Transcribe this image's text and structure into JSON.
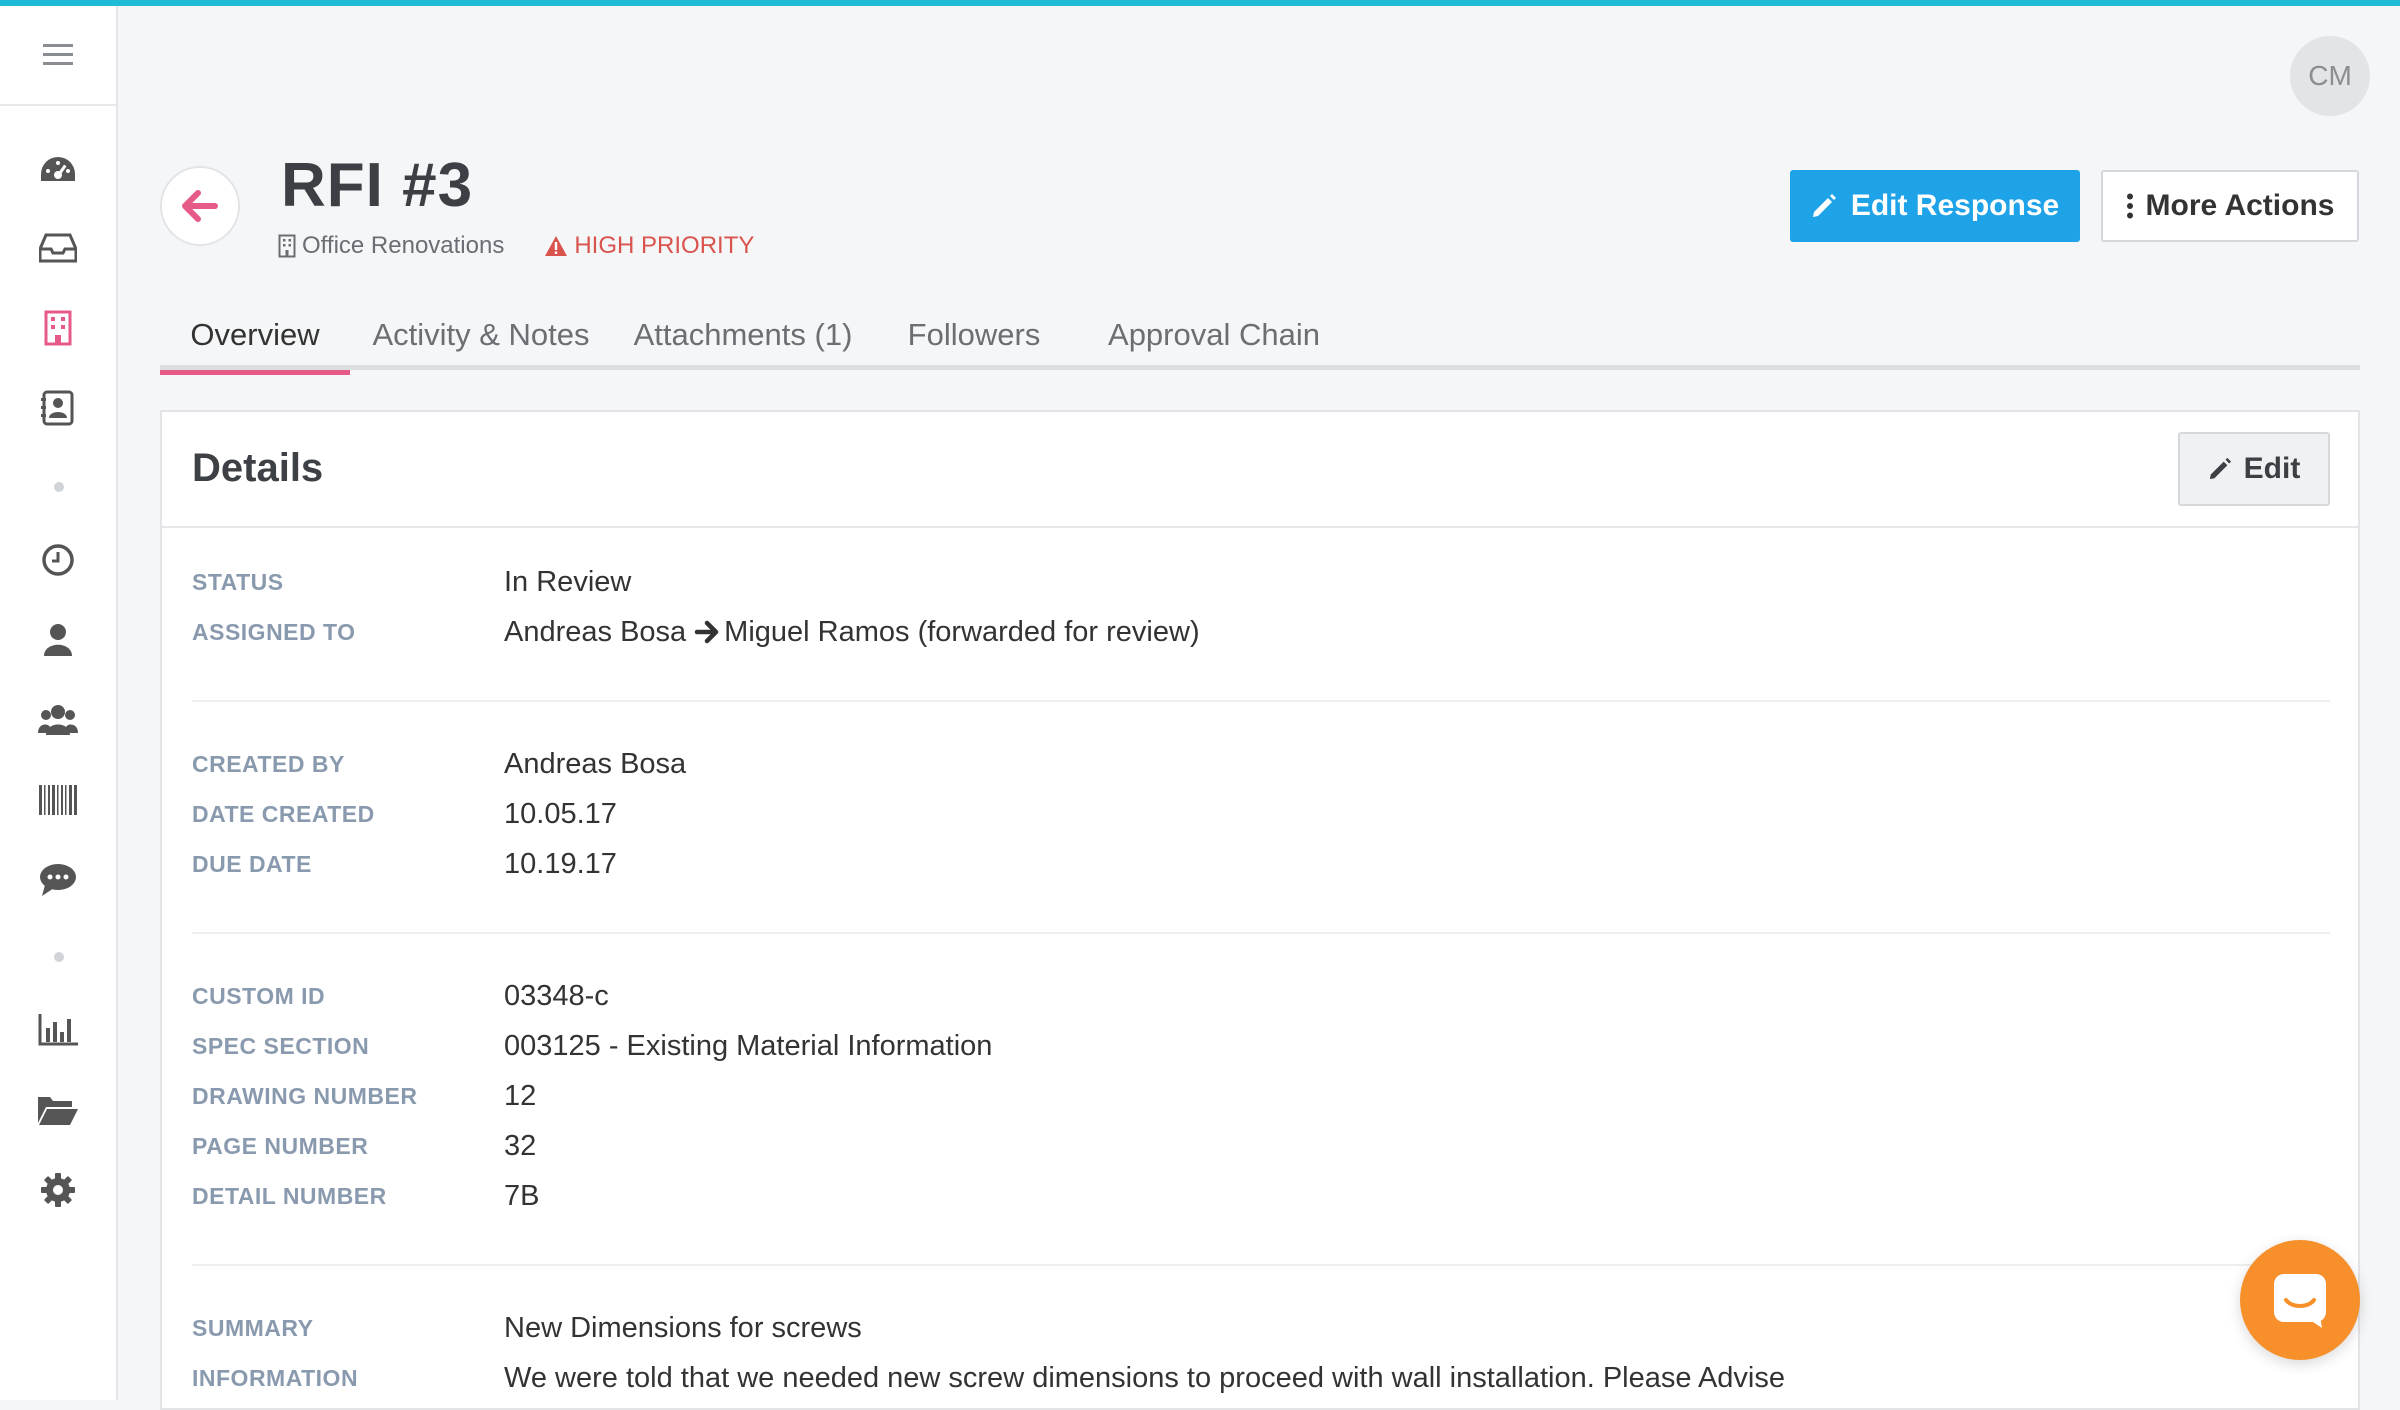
{
  "user": {
    "initials": "CM"
  },
  "header": {
    "title": "RFI #3",
    "project": "Office Renovations",
    "priority": "HIGH PRIORITY",
    "primary_action": "Edit Response",
    "secondary_action": "More Actions"
  },
  "tabs": [
    {
      "label": "Overview",
      "active": true
    },
    {
      "label": "Activity & Notes",
      "active": false
    },
    {
      "label": "Attachments (1)",
      "active": false
    },
    {
      "label": "Followers",
      "active": false
    },
    {
      "label": "Approval Chain",
      "active": false
    }
  ],
  "sidebar": {
    "icons": [
      "menu-icon",
      "dashboard-icon",
      "inbox-icon",
      "building-icon",
      "contacts-icon",
      "clock-icon",
      "user-icon",
      "team-icon",
      "barcode-icon",
      "chat-icon",
      "chart-icon",
      "folder-icon",
      "gear-icon"
    ],
    "active": "building-icon"
  },
  "details": {
    "title": "Details",
    "edit_label": "Edit",
    "status_label": "STATUS",
    "status_value": "In Review",
    "assigned_label": "ASSIGNED TO",
    "assigned_from": "Andreas Bosa",
    "assigned_to": "Miguel Ramos (forwarded for review)",
    "created_by_label": "CREATED BY",
    "created_by_value": "Andreas Bosa",
    "date_created_label": "DATE CREATED",
    "date_created_value": "10.05.17",
    "due_date_label": "DUE DATE",
    "due_date_value": "10.19.17",
    "custom_id_label": "CUSTOM ID",
    "custom_id_value": "03348-c",
    "spec_section_label": "SPEC SECTION",
    "spec_section_value": "003125 - Existing Material Information",
    "drawing_number_label": "DRAWING NUMBER",
    "drawing_number_value": "12",
    "page_number_label": "PAGE NUMBER",
    "page_number_value": "32",
    "detail_number_label": "DETAIL NUMBER",
    "detail_number_value": "7B",
    "summary_label": "SUMMARY",
    "summary_value": "New Dimensions for screws",
    "information_label": "INFORMATION",
    "information_value": "We were told that we needed new screw dimensions to proceed with wall installation. Please Advise"
  },
  "colors": {
    "accent_top": "#1fbad6",
    "primary_button": "#1ea2e8",
    "active_tab": "#e65a87",
    "priority": "#d9534f",
    "chat": "#f78f2b"
  }
}
